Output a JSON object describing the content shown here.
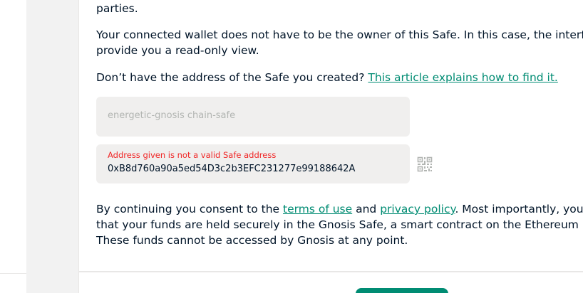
{
  "text": {
    "parties": "parties.",
    "wallet_line1": "Your connected wallet does not have to be the owner of this Safe. In this case, the interface w",
    "wallet_line2": "provide you a read-only view.",
    "address_question": "Don’t have the address of the Safe you created?",
    "address_link": "This article explains how to find it."
  },
  "form": {
    "name_placeholder": "energetic-gnosis chain-safe",
    "address_error": "Address given is not a valid Safe address",
    "address_value": "0xB8d760a90a5ed54D3c2b3EFC231277e99188642A"
  },
  "consent": {
    "line1_a": "By continuing you consent to the",
    "terms_link": "terms of use",
    "and": "and",
    "privacy_link": "privacy policy",
    "line1_b": ". Most importantly, you confi",
    "line2": "that your funds are held securely in the Gnosis Safe, a smart contract on the Ethereum blockc",
    "line3": "These funds cannot be accessed by Gnosis at any point."
  },
  "icons": {
    "qr": "qr-code-icon"
  },
  "colors": {
    "accent": "#008c73",
    "error": "#f02525",
    "text": "#001428",
    "field_bg": "#f0efee"
  }
}
